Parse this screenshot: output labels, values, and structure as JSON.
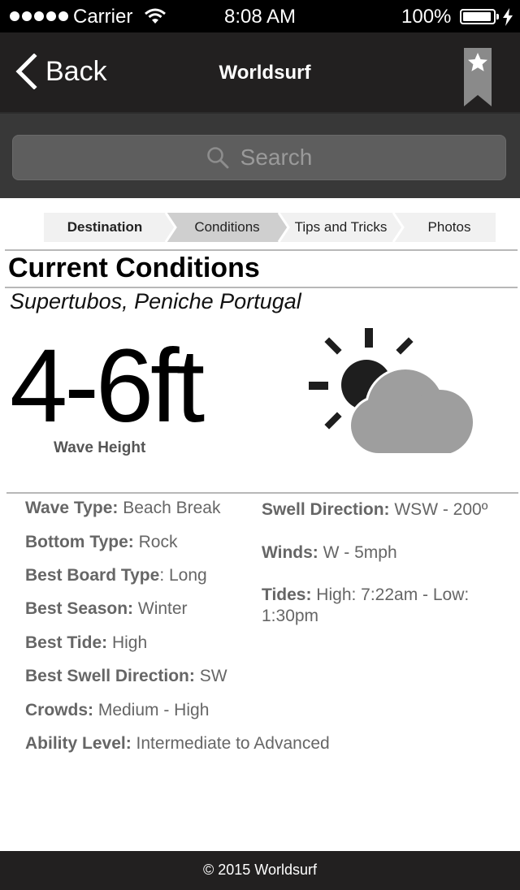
{
  "status_bar": {
    "carrier": "Carrier",
    "time": "8:08 AM",
    "battery": "100%"
  },
  "nav": {
    "back_label": "Back",
    "title": "Worldsurf",
    "bookmark_icon": "star-bookmark-icon"
  },
  "search": {
    "placeholder": "Search"
  },
  "tabs": [
    {
      "label": "Destination",
      "active": false
    },
    {
      "label": "Conditions",
      "active": true
    },
    {
      "label": "Tips and Tricks",
      "active": false
    },
    {
      "label": "Photos",
      "active": false
    }
  ],
  "conditions": {
    "heading": "Current Conditions",
    "location": "Supertubos, Peniche Portugal",
    "wave_height": "4-6ft",
    "wave_height_label": "Wave Height",
    "weather_icon": "partly-cloudy-icon"
  },
  "details_left": [
    {
      "label": "Wave Type:",
      "value": " Beach Break"
    },
    {
      "label": "Bottom Type:",
      "value": " Rock"
    },
    {
      "label": "Best Board Type",
      "value": ": Long"
    },
    {
      "label": "Best Season:",
      "value": " Winter"
    },
    {
      "label": "Best Tide:",
      "value": " High"
    },
    {
      "label": "Best Swell Direction:",
      "value": " SW"
    },
    {
      "label": "Crowds:",
      "value": " Medium - High"
    },
    {
      "label": "Ability Level:",
      "value": " Intermediate to Advanced"
    }
  ],
  "details_right": [
    {
      "label": "Swell Direction:",
      "value": " WSW - 200º"
    },
    {
      "label": "Winds:",
      "value": " W - 5mph"
    },
    {
      "label": "Tides:",
      "value": " High: 7:22am -  Low: 1:30pm"
    }
  ],
  "footer": {
    "text": "© 2015 Worldsurf"
  }
}
